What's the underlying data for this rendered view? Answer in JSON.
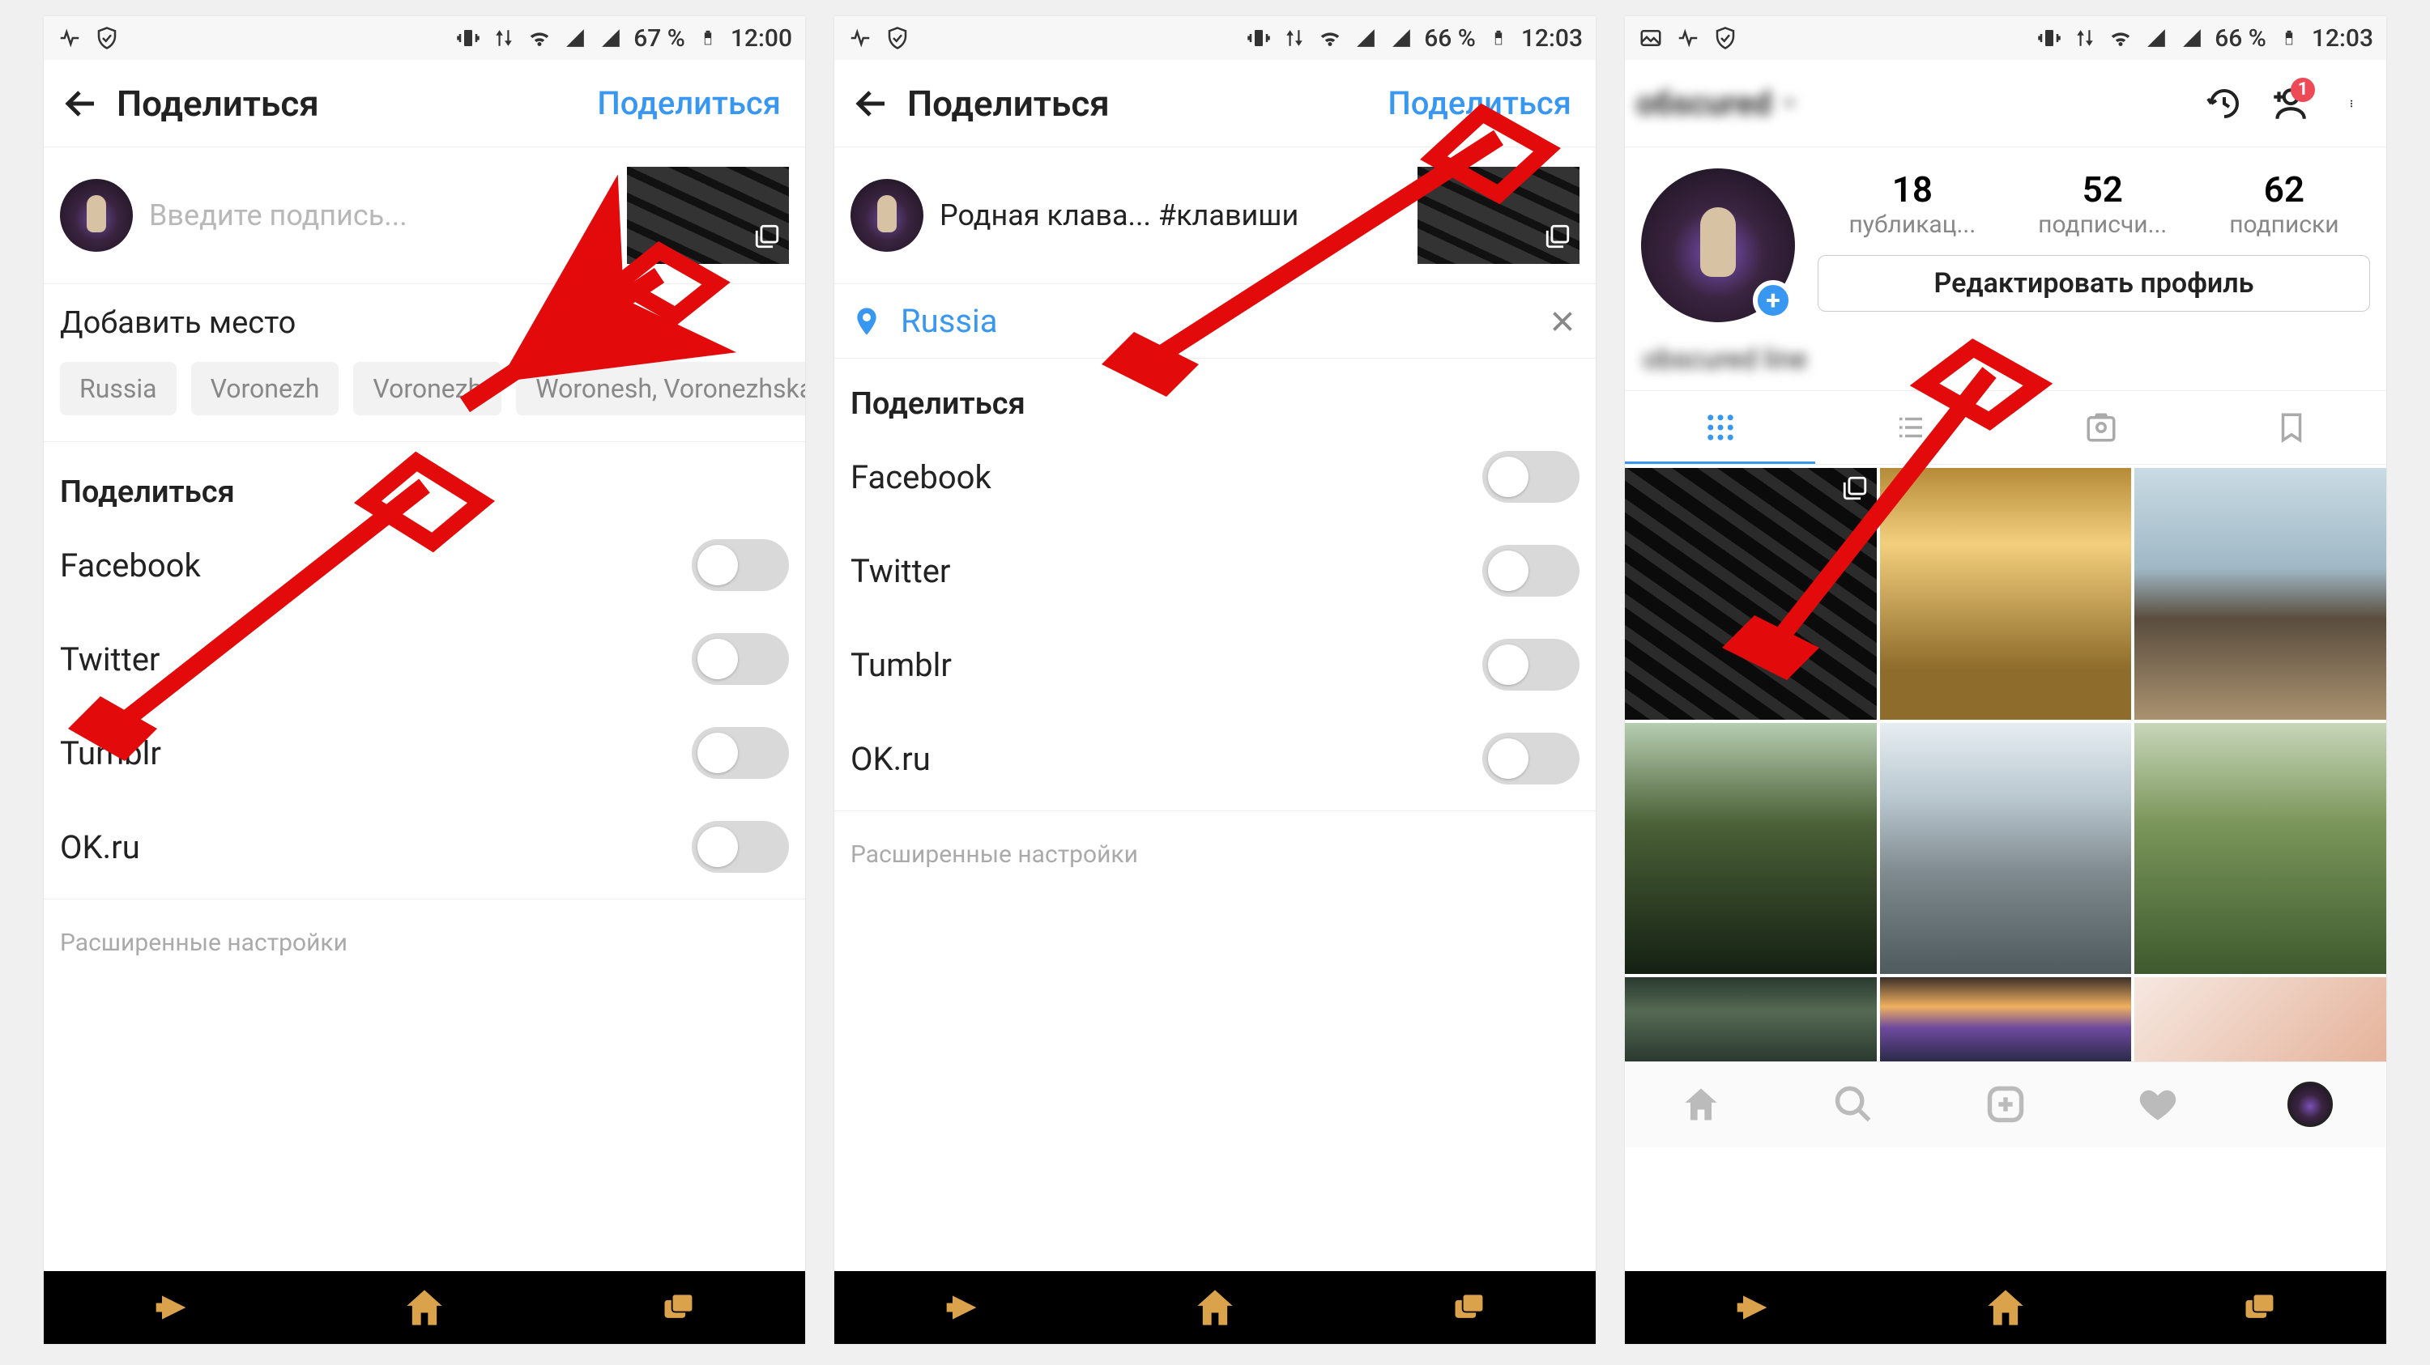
{
  "statusbar": {
    "battery1": "67 %",
    "time1": "12:00",
    "battery2": "66 %",
    "time2": "12:03",
    "battery3": "66 %",
    "time3": "12:03"
  },
  "screen1": {
    "title": "Поделиться",
    "action": "Поделиться",
    "caption_placeholder": "Введите подпись...",
    "add_location": "Добавить место",
    "chips": [
      "Russia",
      "Voronezh",
      "Voronezh",
      "Woronesh, Voronezhska..."
    ],
    "share_title": "Поделиться",
    "share_items": [
      "Facebook",
      "Twitter",
      "Tumblr",
      "OK.ru"
    ],
    "advanced": "Расширенные настройки"
  },
  "screen2": {
    "title": "Поделиться",
    "action": "Поделиться",
    "caption_value": "Родная клава... #клавиши",
    "location": "Russia",
    "share_title": "Поделиться",
    "share_items": [
      "Facebook",
      "Twitter",
      "Tumblr",
      "OK.ru"
    ],
    "advanced": "Расширенные настройки"
  },
  "screen3": {
    "username": "обscured",
    "stats": {
      "posts": {
        "n": "18",
        "l": "публикац..."
      },
      "followers": {
        "n": "52",
        "l": "подписчи..."
      },
      "following": {
        "n": "62",
        "l": "подписки"
      }
    },
    "edit_profile": "Редактировать профиль",
    "bio": "obscured line",
    "badge": "1"
  }
}
